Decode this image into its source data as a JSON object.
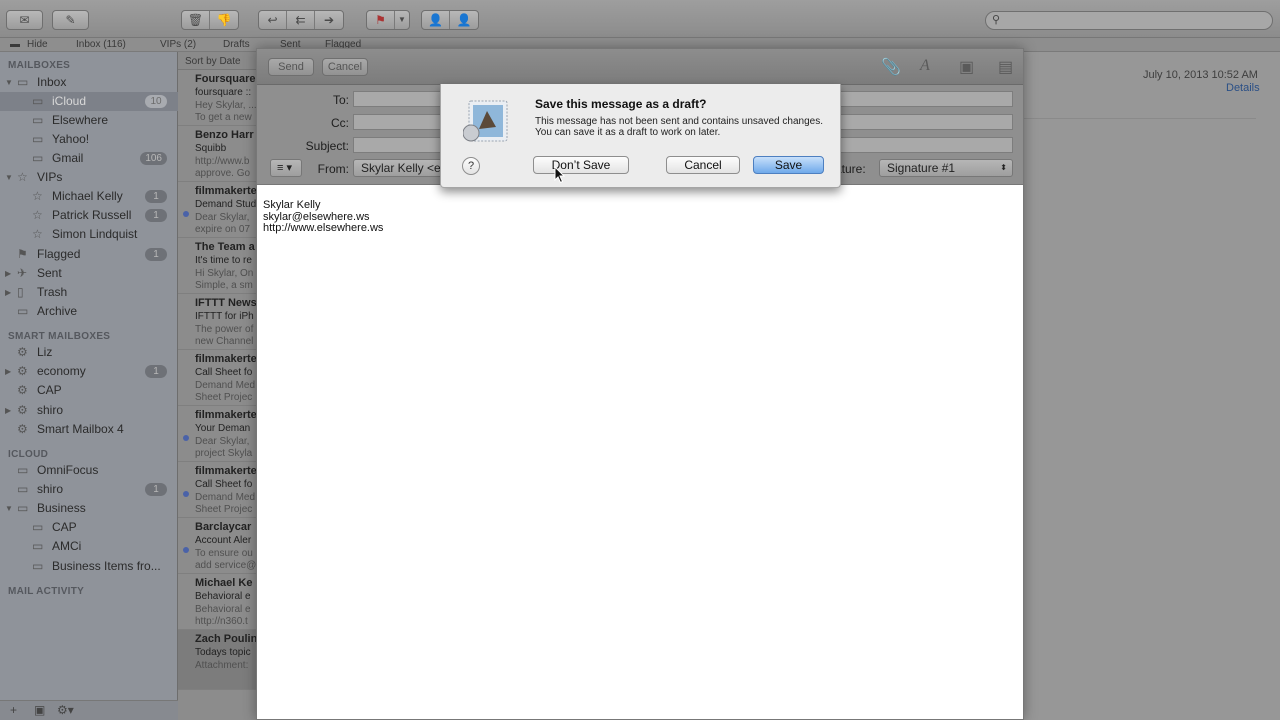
{
  "toolbar": {
    "get_mail_icon": "envelope-icon",
    "compose_icon": "compose-icon",
    "delete_icon": "trash-icon",
    "junk_icon": "thumbs-down-icon",
    "reply_icon": "reply-icon",
    "reply_all_icon": "reply-all-icon",
    "forward_icon": "forward-icon",
    "flag_icon": "flag-icon",
    "add_contact_icon": "add-contact-icon",
    "contact_icon": "contact-icon",
    "search_icon": "search-icon"
  },
  "favorites_bar": {
    "hide": "Hide",
    "inbox": "Inbox (116)",
    "vips": "VIPs (2)",
    "drafts": "Drafts",
    "sent": "Sent",
    "flagged": "Flagged"
  },
  "sidebar": {
    "mailboxes_header": "MAILBOXES",
    "smart_header": "SMART MAILBOXES",
    "icloud_header": "ICLOUD",
    "activity_header": "MAIL ACTIVITY",
    "items": [
      {
        "label": "Inbox",
        "badge": ""
      },
      {
        "label": "iCloud",
        "badge": "10"
      },
      {
        "label": "Elsewhere",
        "badge": ""
      },
      {
        "label": "Yahoo!",
        "badge": ""
      },
      {
        "label": "Gmail",
        "badge": "106"
      },
      {
        "label": "VIPs",
        "badge": ""
      },
      {
        "label": "Michael Kelly",
        "badge": "1"
      },
      {
        "label": "Patrick Russell",
        "badge": "1"
      },
      {
        "label": "Simon Lindquist",
        "badge": ""
      },
      {
        "label": "Flagged",
        "badge": "1"
      },
      {
        "label": "Sent",
        "badge": ""
      },
      {
        "label": "Trash",
        "badge": ""
      },
      {
        "label": "Archive",
        "badge": ""
      },
      {
        "label": "Liz",
        "badge": ""
      },
      {
        "label": "economy",
        "badge": "1"
      },
      {
        "label": "CAP",
        "badge": ""
      },
      {
        "label": "shiro",
        "badge": ""
      },
      {
        "label": "Smart Mailbox 4",
        "badge": ""
      },
      {
        "label": "OmniFocus",
        "badge": ""
      },
      {
        "label": "shiro",
        "badge": "1"
      },
      {
        "label": "Business",
        "badge": ""
      },
      {
        "label": "CAP",
        "badge": ""
      },
      {
        "label": "AMCi",
        "badge": ""
      },
      {
        "label": "Business Items fro...",
        "badge": ""
      }
    ]
  },
  "message_list": {
    "sort": "Sort by Date",
    "messages": [
      {
        "from": "Foursquare",
        "l1": "foursquare ::",
        "l2": "Hey Skylar, ...",
        "l3": "To get a new"
      },
      {
        "from": "Benzo Harr",
        "l1": "Squibb",
        "l2": "http://www.b",
        "l3": "approve. Go"
      },
      {
        "from": "filmmakerte",
        "l1": "Demand Stud",
        "l2": "Dear Skylar,",
        "l3": "expire on 07"
      },
      {
        "from": "The Team a",
        "l1": "It's time to re",
        "l2": "Hi Skylar, On",
        "l3": "Simple, a sm"
      },
      {
        "from": "IFTTT News",
        "l1": "IFTTT for iPh",
        "l2": "The power of",
        "l3": "new Channel"
      },
      {
        "from": "filmmakerte",
        "l1": "Call Sheet fo",
        "l2": "Demand Med",
        "l3": "Sheet Projec"
      },
      {
        "from": "filmmakerte",
        "l1": "Your Deman",
        "l2": "Dear Skylar,",
        "l3": "project Skyla"
      },
      {
        "from": "filmmakerte",
        "l1": "Call Sheet fo",
        "l2": "Demand Med",
        "l3": "Sheet Projec"
      },
      {
        "from": "Barclaycar",
        "l1": "Account Aler",
        "l2": "To ensure ou",
        "l3": "add service@"
      },
      {
        "from": "Michael Ke",
        "l1": "Behavioral e",
        "l2": "Behavioral e",
        "l3": "http://n360.t"
      },
      {
        "from": "Zach Poulin",
        "l1": "Todays topic",
        "l2": "Attachment:",
        "l3": ""
      }
    ]
  },
  "reader": {
    "date": "July 10, 2013  10:52 AM",
    "details": "Details"
  },
  "compose": {
    "send": "Send",
    "cancel": "Cancel",
    "to_label": "To:",
    "cc_label": "Cc:",
    "subject_label": "Subject:",
    "from_label": "From:",
    "from_value": "Skylar Kelly <e",
    "signature_label": "ature:",
    "signature_value": "Signature #1",
    "list_button": "≡ ▾",
    "body_lines": [
      "Skylar Kelly",
      "skylar@elsewhere.ws",
      "http://www.elsewhere.ws"
    ]
  },
  "dialog": {
    "title": "Save this message as a draft?",
    "message": "This message has not been sent and contains unsaved changes. You can save it as a draft to work on later.",
    "help": "?",
    "dont_save": "Don’t Save",
    "cancel": "Cancel",
    "save": "Save"
  },
  "colors": {
    "accent": "#6fa9ea",
    "badge": "#6e7177",
    "unread_dot": "#4a62a8"
  }
}
